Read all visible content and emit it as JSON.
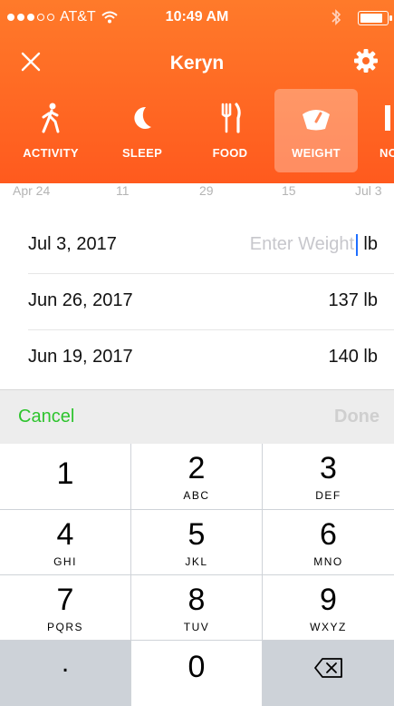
{
  "status_bar": {
    "carrier": "AT&T",
    "time": "10:49 AM"
  },
  "nav": {
    "title": "Keryn",
    "close_icon": "close-icon",
    "settings_icon": "gear-icon"
  },
  "tabs": [
    {
      "label": "ACTIVITY",
      "icon": "walking-person-icon"
    },
    {
      "label": "SLEEP",
      "icon": "moon-icon"
    },
    {
      "label": "FOOD",
      "icon": "fork-knife-icon"
    },
    {
      "label": "WEIGHT",
      "icon": "scale-icon",
      "active": true
    },
    {
      "label": "NO",
      "icon": "note-icon"
    }
  ],
  "axis_ticks": [
    "Apr 24",
    "11",
    "29",
    "15",
    "Jul 3"
  ],
  "entries": [
    {
      "date": "Jul 3, 2017",
      "placeholder": "Enter Weight",
      "unit": "lb"
    },
    {
      "date": "Jun 26, 2017",
      "value": "137 lb"
    },
    {
      "date": "Jun 19, 2017",
      "value": "140 lb"
    }
  ],
  "toolbar": {
    "cancel": "Cancel",
    "done": "Done"
  },
  "keypad": {
    "keys": [
      {
        "num": "1",
        "letters": ""
      },
      {
        "num": "2",
        "letters": "ABC"
      },
      {
        "num": "3",
        "letters": "DEF"
      },
      {
        "num": "4",
        "letters": "GHI"
      },
      {
        "num": "5",
        "letters": "JKL"
      },
      {
        "num": "6",
        "letters": "MNO"
      },
      {
        "num": "7",
        "letters": "PQRS"
      },
      {
        "num": "8",
        "letters": "TUV"
      },
      {
        "num": "9",
        "letters": "WXYZ"
      }
    ],
    "decimal": ".",
    "zero": "0",
    "delete_icon": "backspace-icon"
  },
  "colors": {
    "header": "#ff6224",
    "accent_green": "#2ec42e",
    "cursor": "#1f6fff"
  }
}
